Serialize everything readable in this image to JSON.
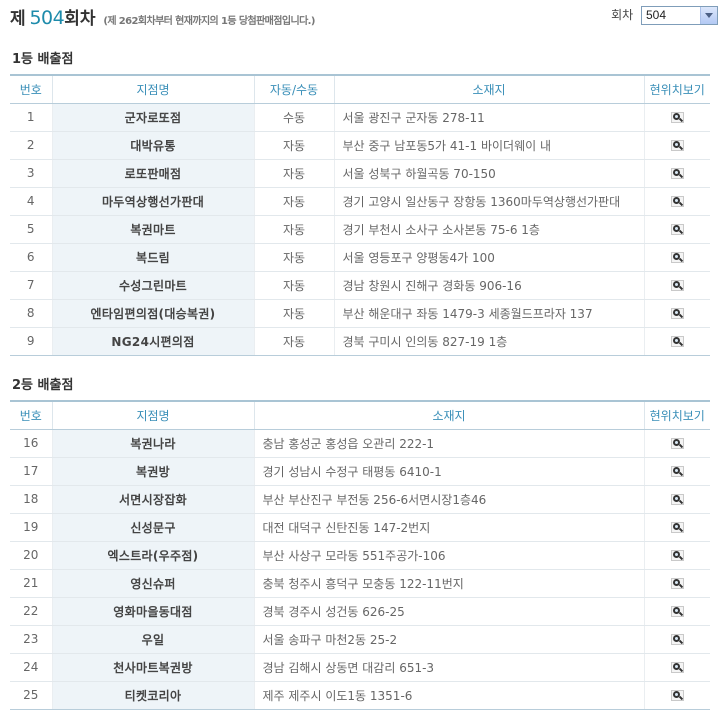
{
  "round": {
    "prefix": "제",
    "number": "504",
    "suffix": "회차",
    "note": "(제 262회차부터 현재까지의 1등 당첨판매점입니다.)",
    "select_label": "회차",
    "select_value": "504"
  },
  "first": {
    "title": "1등 배출점",
    "headers": {
      "no": "번호",
      "name": "지점명",
      "type": "자동/수동",
      "address": "소재지",
      "location": "현위치보기"
    },
    "rows": [
      {
        "no": "1",
        "name": "군자로또점",
        "type": "수동",
        "address": "서울 광진구 군자동 278-11"
      },
      {
        "no": "2",
        "name": "대박유통",
        "type": "자동",
        "address": "부산 중구 남포동5가 41-1 바이더웨이 내"
      },
      {
        "no": "3",
        "name": "로또판매점",
        "type": "자동",
        "address": "서울 성북구 하월곡동 70-150"
      },
      {
        "no": "4",
        "name": "마두역상행선가판대",
        "type": "자동",
        "address": "경기 고양시 일산동구 장항동 1360마두역상행선가판대"
      },
      {
        "no": "5",
        "name": "복권마트",
        "type": "자동",
        "address": "경기 부천시 소사구 소사본동 75-6 1층"
      },
      {
        "no": "6",
        "name": "복드림",
        "type": "자동",
        "address": "서울 영등포구 양평동4가 100"
      },
      {
        "no": "7",
        "name": "수성그린마트",
        "type": "자동",
        "address": "경남 창원시 진해구 경화동 906-16"
      },
      {
        "no": "8",
        "name": "엔타임편의점(대승복권)",
        "type": "자동",
        "address": "부산 해운대구 좌동 1479-3 세종월드프라자 137"
      },
      {
        "no": "9",
        "name": "NG24시편의점",
        "type": "자동",
        "address": "경북 구미시 인의동 827-19 1층"
      }
    ]
  },
  "second": {
    "title": "2등 배출점",
    "headers": {
      "no": "번호",
      "name": "지점명",
      "address": "소재지",
      "location": "현위치보기"
    },
    "rows": [
      {
        "no": "16",
        "name": "복권나라",
        "address": "충남 홍성군 홍성읍 오관리 222-1"
      },
      {
        "no": "17",
        "name": "복권방",
        "address": "경기 성남시 수정구 태평동 6410-1"
      },
      {
        "no": "18",
        "name": "서면시장잡화",
        "address": "부산 부산진구 부전동 256-6서면시장1층46"
      },
      {
        "no": "19",
        "name": "신성문구",
        "address": "대전 대덕구 신탄진동 147-2번지"
      },
      {
        "no": "20",
        "name": "엑스트라(우주점)",
        "address": "부산 사상구 모라동 551주공가-106"
      },
      {
        "no": "21",
        "name": "영신슈퍼",
        "address": "충북 청주시 흥덕구 모충동 122-11번지"
      },
      {
        "no": "22",
        "name": "영화마을동대점",
        "address": "경북 경주시 성건동 626-25"
      },
      {
        "no": "23",
        "name": "우일",
        "address": "서울 송파구 마천2동 25-2"
      },
      {
        "no": "24",
        "name": "천사마트복권방",
        "address": "경남 김해시 상동면 대감리 651-3"
      },
      {
        "no": "25",
        "name": "티켓코리아",
        "address": "제주 제주시 이도1동 1351-6"
      }
    ]
  },
  "icons": {
    "location": "magnifier-icon"
  }
}
